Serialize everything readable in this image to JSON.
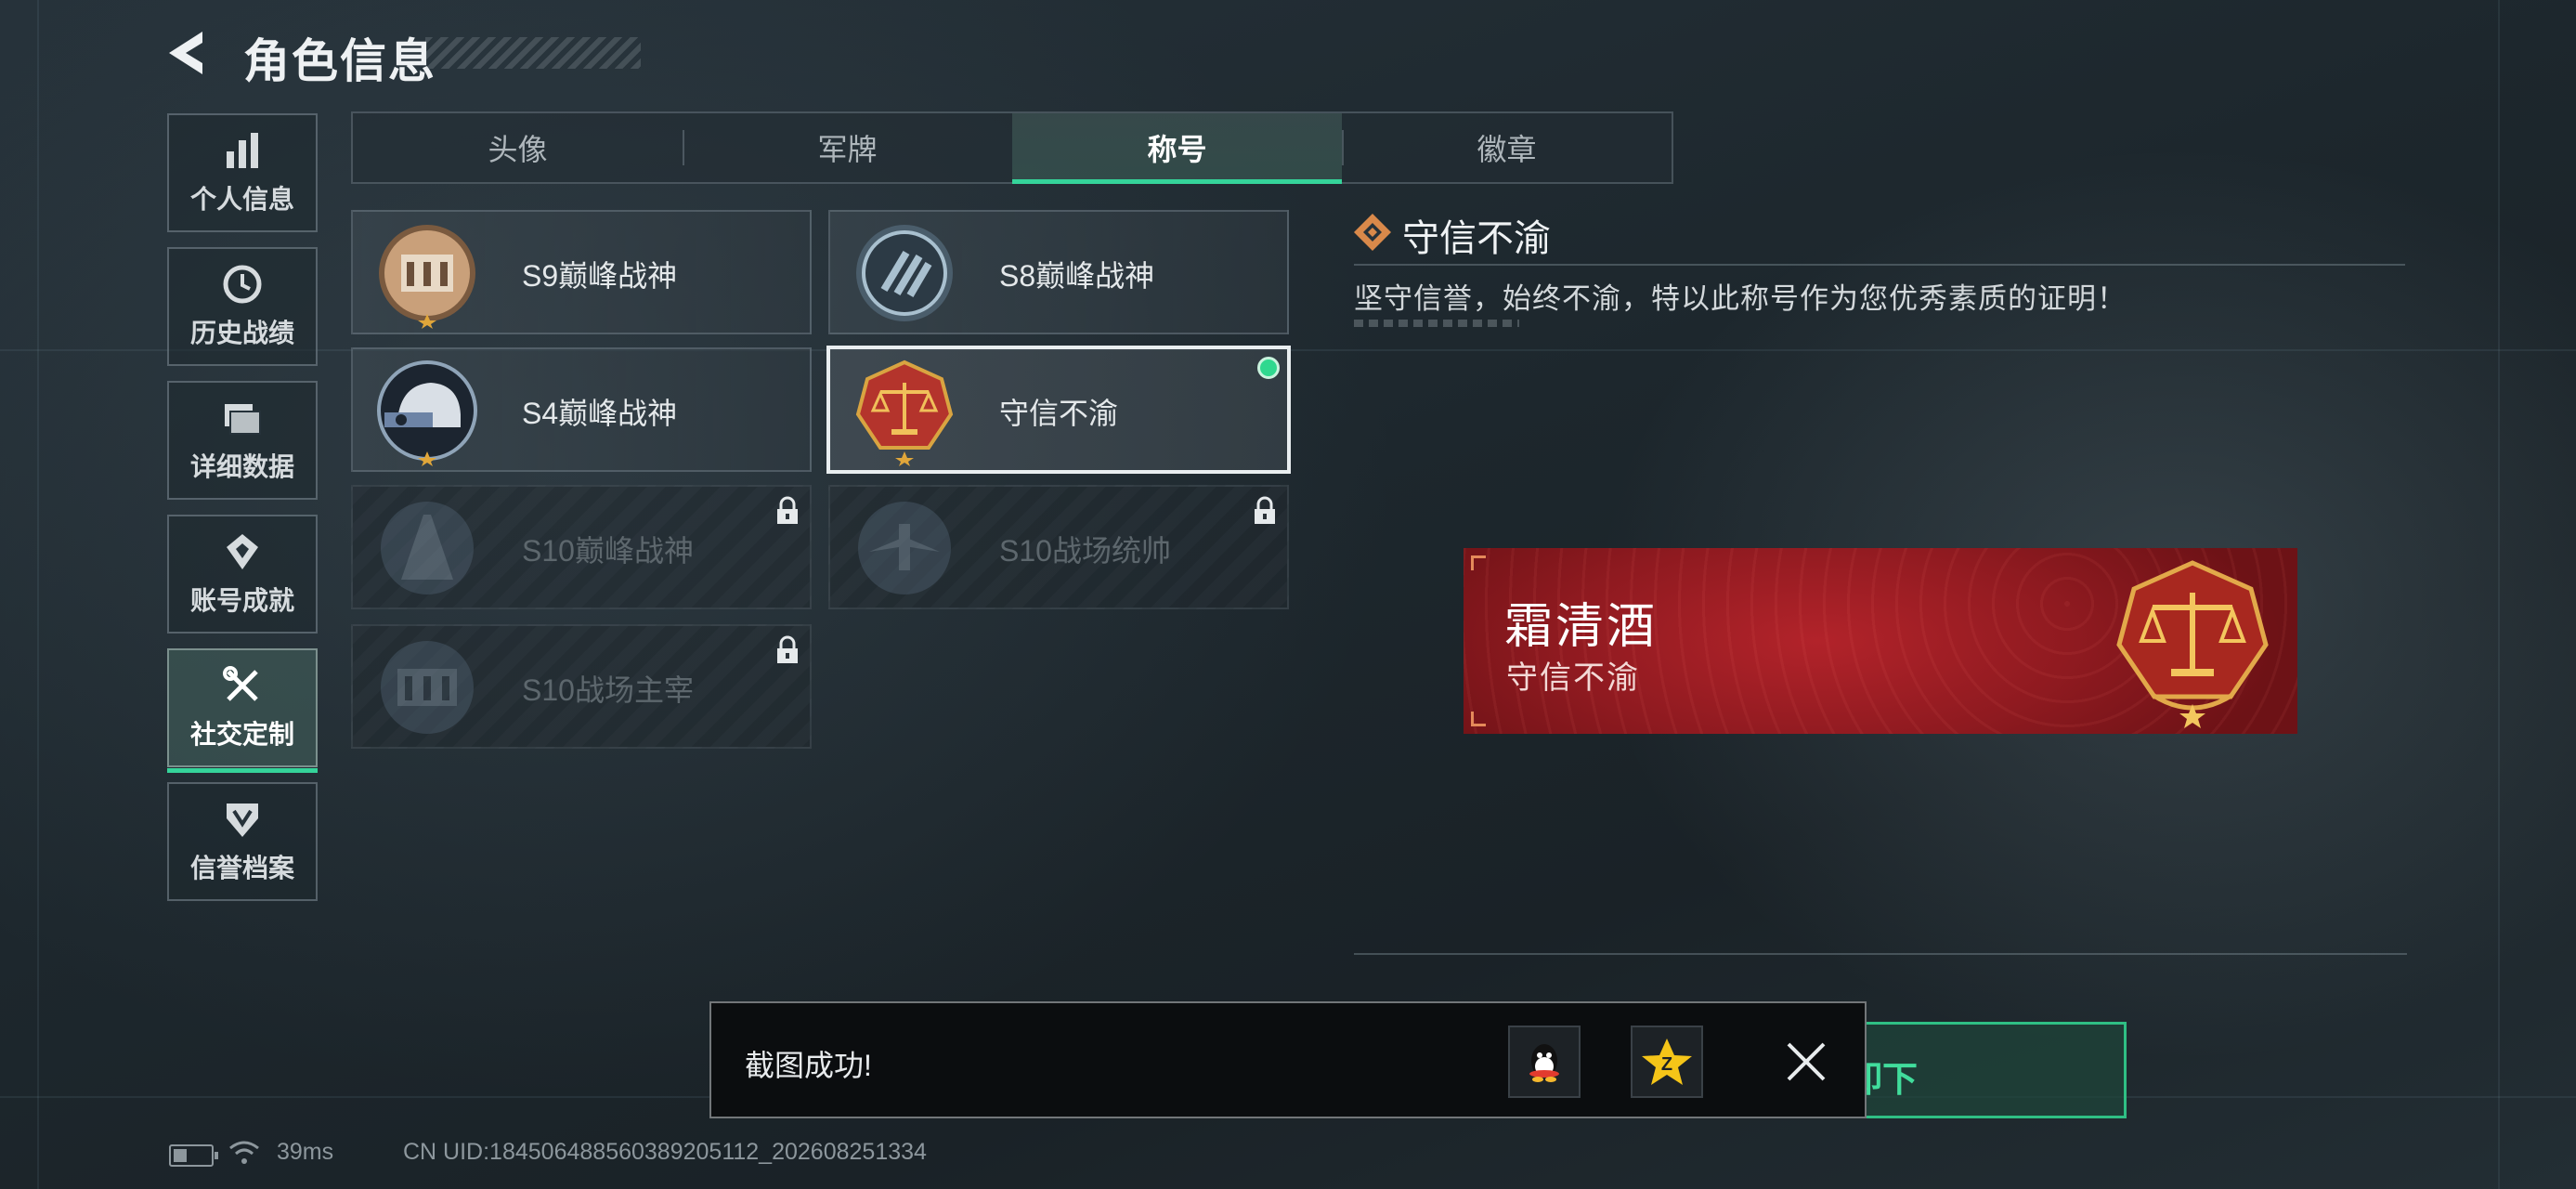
{
  "header": {
    "title": "角色信息"
  },
  "sidebar": {
    "items": [
      {
        "label": "个人信息",
        "icon": "bar-chart-icon"
      },
      {
        "label": "历史战绩",
        "icon": "history-clock-icon"
      },
      {
        "label": "详细数据",
        "icon": "folder-icon"
      },
      {
        "label": "账号成就",
        "icon": "achievement-medal-icon"
      },
      {
        "label": "社交定制",
        "icon": "tools-icon",
        "active": true
      },
      {
        "label": "信誉档案",
        "icon": "credit-shield-icon"
      }
    ]
  },
  "tabs": [
    {
      "label": "头像"
    },
    {
      "label": "军牌"
    },
    {
      "label": "称号",
      "active": true
    },
    {
      "label": "徽章"
    }
  ],
  "titles": [
    {
      "name": "S9巅峰战神",
      "locked": false,
      "icon": "s9-colosseum-badge-icon"
    },
    {
      "name": "S8巅峰战神",
      "locked": false,
      "icon": "s8-stripes-badge-icon"
    },
    {
      "name": "S4巅峰战神",
      "locked": false,
      "icon": "s4-helmet-badge-icon"
    },
    {
      "name": "守信不渝",
      "locked": false,
      "selected": true,
      "equipped": true,
      "icon": "scales-badge-icon"
    },
    {
      "name": "S10巅峰战神",
      "locked": true,
      "icon": "s10-building-badge-icon"
    },
    {
      "name": "S10战场统帅",
      "locked": true,
      "icon": "s10-plane-badge-icon"
    },
    {
      "name": "S10战场主宰",
      "locked": true,
      "icon": "s10-colosseum-badge-icon"
    }
  ],
  "detail": {
    "name": "守信不渝",
    "description": "坚守信誉，始终不渝，特以此称号作为您优秀素质的证明！"
  },
  "nameplate": {
    "player": "霜清酒",
    "title": "守信不渝"
  },
  "unequip_button": {
    "label": "卸下"
  },
  "toast": {
    "message": "截图成功!",
    "share_targets": [
      "qq-share-icon",
      "qzone-share-icon"
    ]
  },
  "statusbar": {
    "latency": "39ms",
    "uid": "CN UID:1845064885603892051​12_202608251334"
  },
  "colors": {
    "accent": "#35d49a",
    "plate_red": "#b2232a",
    "gold": "#d9a441"
  }
}
